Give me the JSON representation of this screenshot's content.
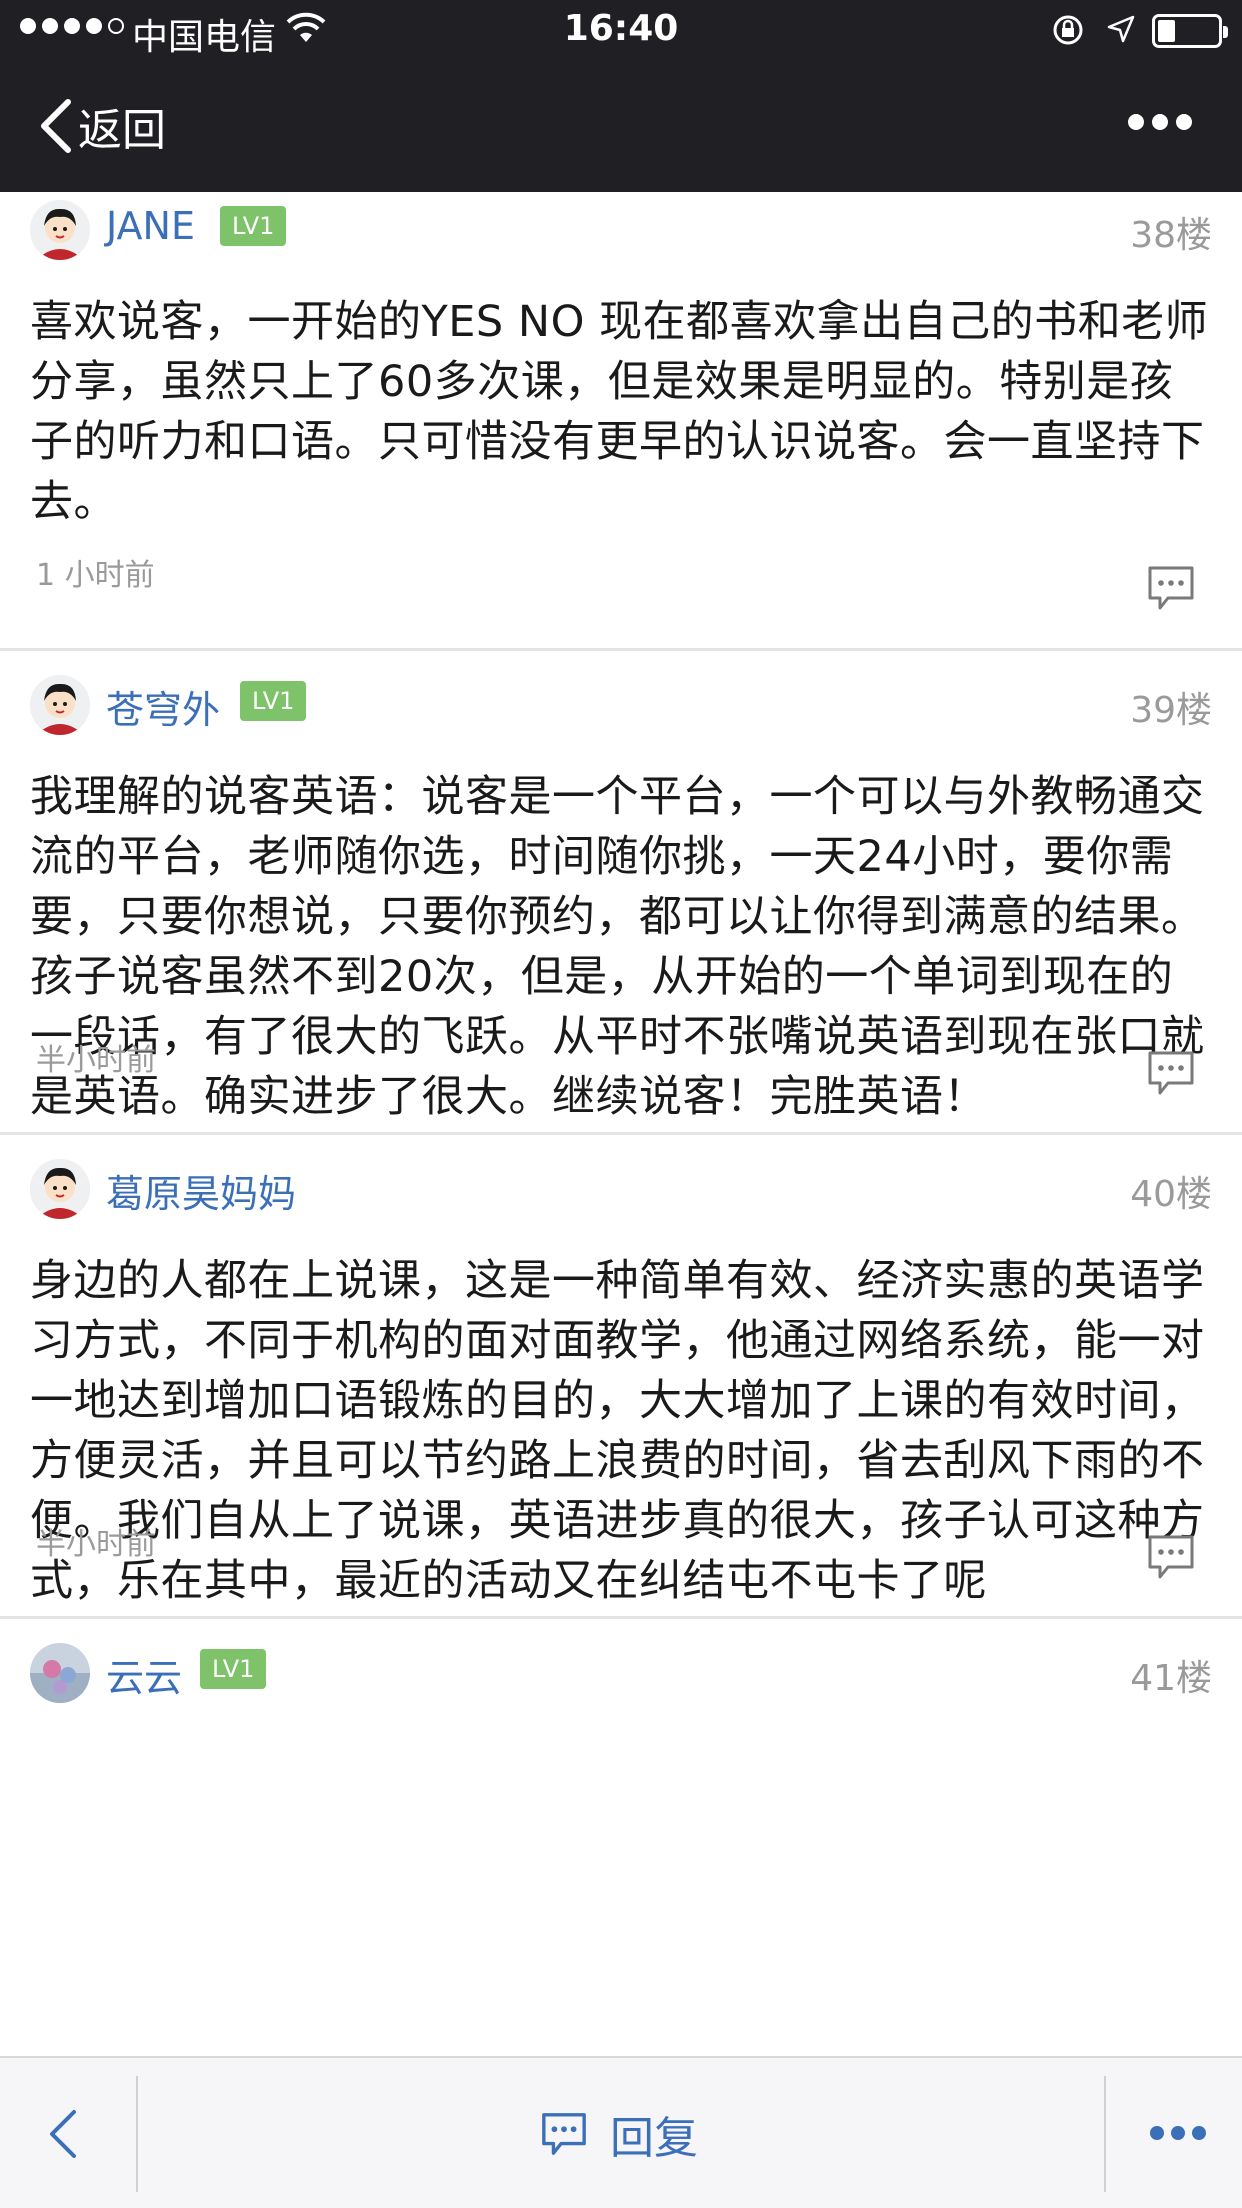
{
  "status_bar": {
    "carrier": "中国电信",
    "time": "16:40",
    "battery_level": 0.3
  },
  "nav": {
    "back_label": "返回"
  },
  "posts": [
    {
      "username": "JANE",
      "level": "LV1",
      "floor": "38楼",
      "content": "喜欢说客，一开始的YES NO 现在都喜欢拿出自己的书和老师分享，虽然只上了60多次课，但是效果是明显的。特别是孩子的听力和口语。只可惜没有更早的认识说客。会一直坚持下去。",
      "time": "1 小时前"
    },
    {
      "username": "苍穹外",
      "level": "LV1",
      "floor": "39楼",
      "content": "我理解的说客英语：说客是一个平台，一个可以与外教畅通交流的平台，老师随你选，时间随你挑，一天24小时，要你需要，只要你想说，只要你预约，都可以让你得到满意的结果。孩子说客虽然不到20次，但是，从开始的一个单词到现在的一段话，有了很大的飞跃。从平时不张嘴说英语到现在张口就是英语。确实进步了很大。继续说客！完胜英语！",
      "time": "半小时前"
    },
    {
      "username": "葛原昊妈妈",
      "level": "",
      "floor": "40楼",
      "content": "身边的人都在上说课，这是一种简单有效、经济实惠的英语学习方式，不同于机构的面对面教学，他通过网络系统，能一对一地达到增加口语锻炼的目的，大大增加了上课的有效时间，方便灵活，并且可以节约路上浪费的时间，省去刮风下雨的不便。我们自从上了说课，英语进步真的很大，孩子认可这种方式，乐在其中，最近的活动又在纠结屯不屯卡了呢",
      "time": "半小时前"
    },
    {
      "username": "云云",
      "level": "LV1",
      "floor": "41楼",
      "content": "",
      "time": ""
    }
  ],
  "bottom_bar": {
    "reply_label": "回复"
  },
  "colors": {
    "nav_bg": "#1f1f24",
    "link_blue": "#3b6fb8",
    "badge_green": "#7ec26a",
    "muted_gray": "#9a9a9a"
  }
}
